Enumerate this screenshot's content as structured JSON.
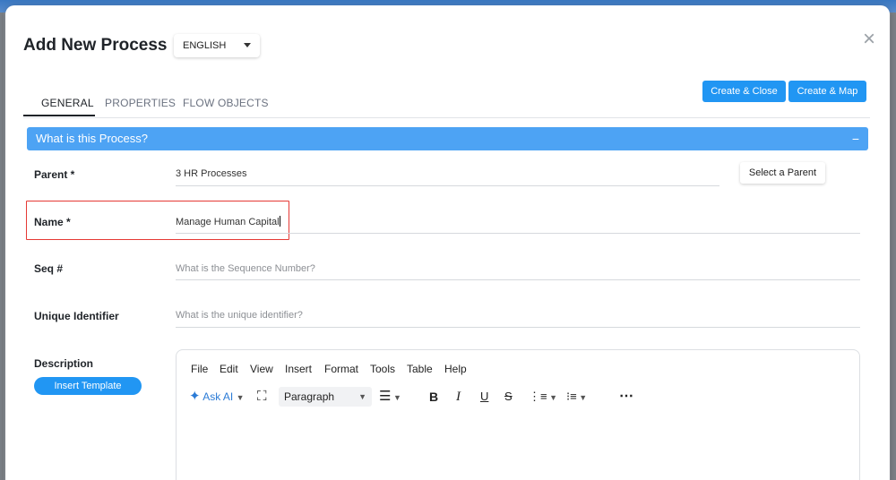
{
  "modal": {
    "title": "Add New Process",
    "close_glyph": "×",
    "language": "ENGLISH"
  },
  "tabs": [
    {
      "label": "GENERAL",
      "active": true
    },
    {
      "label": "PROPERTIES",
      "active": false
    },
    {
      "label": "FLOW OBJECTS",
      "active": false
    }
  ],
  "actions": {
    "create_close": "Create & Close",
    "create_map": "Create & Map"
  },
  "section": {
    "title": "What is this Process?",
    "collapse_glyph": "−"
  },
  "form": {
    "parent": {
      "label": "Parent  *",
      "value": "3 HR Processes",
      "button": "Select a Parent"
    },
    "name": {
      "label": "Name *",
      "value": "Manage Human Capital"
    },
    "seq": {
      "label": "Seq #",
      "placeholder": "What is the Sequence Number?"
    },
    "unique_id": {
      "label": "Unique Identifier",
      "placeholder": "What is the unique identifier?"
    },
    "description": {
      "label": "Description",
      "insert_template": "Insert Template"
    }
  },
  "editor": {
    "menu": [
      "File",
      "Edit",
      "View",
      "Insert",
      "Format",
      "Tools",
      "Table",
      "Help"
    ],
    "toolbar": {
      "ask_ai": "Ask AI",
      "block_format": "Paragraph"
    }
  },
  "colors": {
    "primary": "#2196f3",
    "section_bar": "#4da3f4",
    "highlight": "#e53935"
  }
}
